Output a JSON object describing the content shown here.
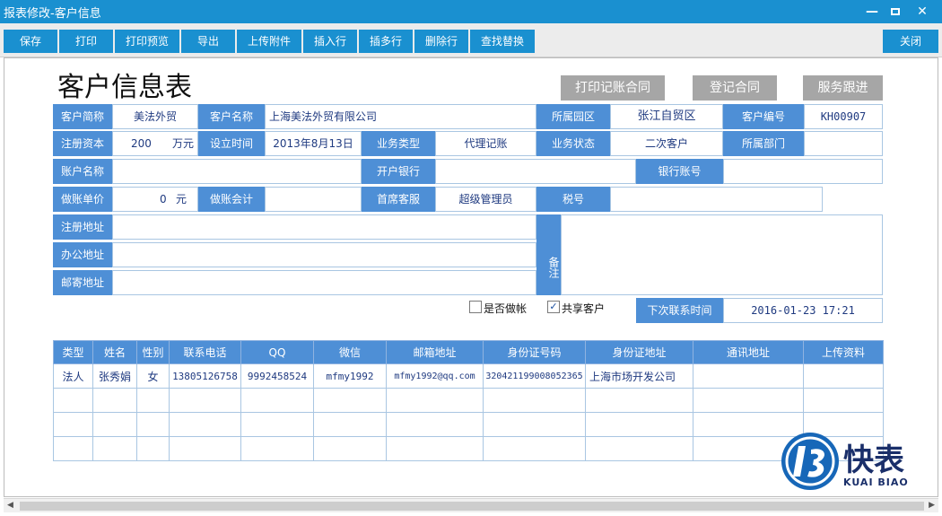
{
  "window": {
    "title": "报表修改-客户信息"
  },
  "toolbar": {
    "save": "保存",
    "print": "打印",
    "preview": "打印预览",
    "export": "导出",
    "upload": "上传附件",
    "insert_row": "插入行",
    "insert_rows": "插多行",
    "delete_row": "删除行",
    "find_replace": "查找替换",
    "close": "关闭"
  },
  "doc": {
    "title": "客户信息表",
    "print_contract": "打印记账合同",
    "register_contract": "登记合同",
    "service_follow": "服务跟进"
  },
  "form": {
    "short_name_label": "客户简称",
    "short_name": "美法外贸",
    "name_label": "客户名称",
    "name": "上海美法外贸有限公司",
    "park_label": "所属园区",
    "park": "张江自贸区",
    "code_label": "客户编号",
    "code": "KH00907",
    "capital_label": "注册资本",
    "capital": "200",
    "capital_unit": "万元",
    "setup_label": "设立时间",
    "setup": "2013年8月13日",
    "biz_type_label": "业务类型",
    "biz_type": "代理记账",
    "biz_status_label": "业务状态",
    "biz_status": "二次客户",
    "dept_label": "所属部门",
    "dept": "",
    "account_name_label": "账户名称",
    "account_name": "",
    "bank_label": "开户银行",
    "bank": "",
    "bank_account_label": "银行账号",
    "bank_account": "",
    "price_label": "做账单价",
    "price": "0",
    "price_unit": "元",
    "accountant_label": "做账会计",
    "accountant": "",
    "service_label": "首席客服",
    "service": "超级管理员",
    "tax_label": "税号",
    "tax": "",
    "reg_addr_label": "注册地址",
    "reg_addr": "",
    "office_addr_label": "办公地址",
    "office_addr": "",
    "mail_addr_label": "邮寄地址",
    "mail_addr": "",
    "remark_label": "备注",
    "remark": "",
    "is_booking_label": "是否做帐",
    "is_booking": false,
    "shared_label": "共享客户",
    "shared": true,
    "next_contact_label": "下次联系时间",
    "next_contact": "2016-01-23 17:21"
  },
  "contacts": {
    "headers": [
      "类型",
      "姓名",
      "性别",
      "联系电话",
      "QQ",
      "微信",
      "邮箱地址",
      "身份证号码",
      "身份证地址",
      "通讯地址",
      "上传资料"
    ],
    "rows": [
      [
        "法人",
        "张秀娟",
        "女",
        "13805126758",
        "9992458524",
        "mfmy1992",
        "mfmy1992@qq.com",
        "320421199008052365",
        "上海市场开发公司",
        "",
        ""
      ],
      [
        "",
        "",
        "",
        "",
        "",
        "",
        "",
        "",
        "",
        "",
        ""
      ],
      [
        "",
        "",
        "",
        "",
        "",
        "",
        "",
        "",
        "",
        "",
        ""
      ],
      [
        "",
        "",
        "",
        "",
        "",
        "",
        "",
        "",
        "",
        "",
        ""
      ]
    ]
  },
  "logo": {
    "brand": "快表",
    "brand_en": "KUAI BIAO"
  }
}
